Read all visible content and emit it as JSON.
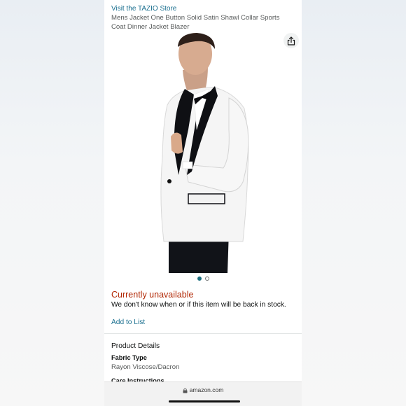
{
  "header": {
    "store_link": "Visit the TAZIO Store",
    "product_title": "Mens Jacket One Button Solid Satin Shawl Collar Sports Coat Dinner Jacket Blazer"
  },
  "gallery": {
    "share_icon": "share-icon",
    "image_count": 2,
    "active_index": 0
  },
  "availability": {
    "status": "Currently unavailable",
    "message": "We don't know when or if this item will be back in stock.",
    "add_to_list": "Add to List"
  },
  "product_details": {
    "title": "Product Details",
    "fabric_type_label": "Fabric Type",
    "fabric_type_value": "Rayon Viscose/Dacron",
    "care_instructions_label": "Care Instructions"
  },
  "browser": {
    "url": "amazon.com",
    "lock_icon": "lock-icon"
  },
  "colors": {
    "link": "#1a6f8f",
    "unavailable": "#b12704",
    "dot_active": "#1d6f80"
  }
}
